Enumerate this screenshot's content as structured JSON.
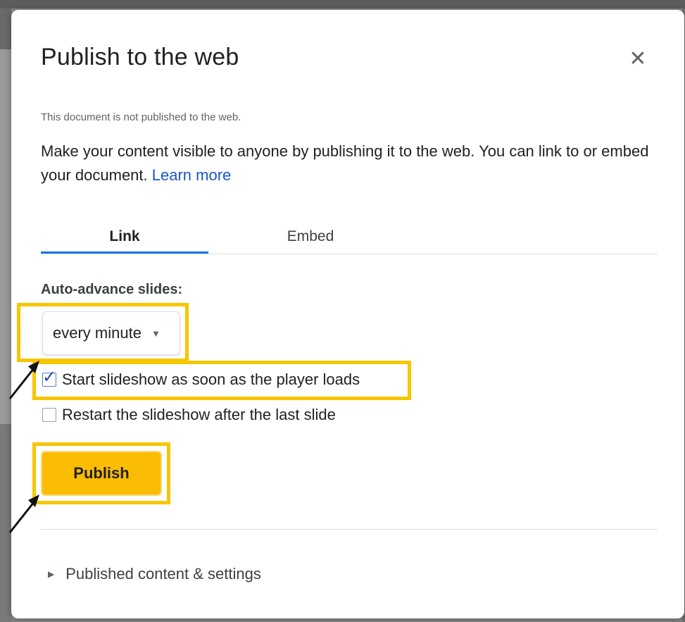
{
  "dialog": {
    "title": "Publish to the web",
    "close_icon": "close-icon",
    "status_text": "This document is not published to the web.",
    "description": "Make your content visible to anyone by publishing it to the web. You can link to or embed your document.",
    "learn_more": "Learn more",
    "tabs": [
      {
        "label": "Link",
        "selected": true
      },
      {
        "label": "Embed",
        "selected": false
      }
    ],
    "auto_advance_label": "Auto-advance slides:",
    "auto_advance_value": "every minute",
    "options": [
      {
        "label": "Start slideshow as soon as the player loads",
        "checked": true
      },
      {
        "label": "Restart the slideshow after the last slide",
        "checked": false
      }
    ],
    "publish_label": "Publish",
    "published_settings_label": "Published content & settings"
  },
  "colors": {
    "highlight": "#f7c600",
    "publish_button": "#fbbc04",
    "tab_underline": "#1a73e8",
    "link": "#1a56c8"
  }
}
